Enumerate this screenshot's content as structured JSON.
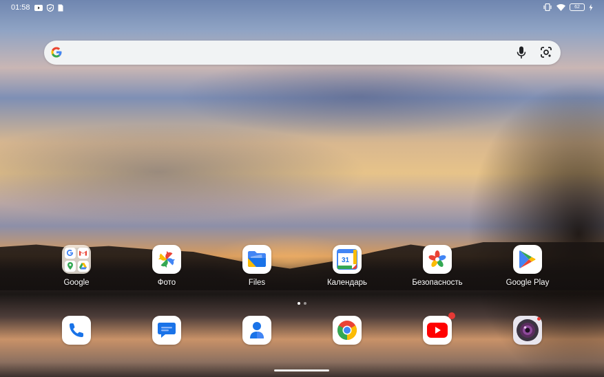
{
  "status_bar": {
    "time": "01:58",
    "battery": "62",
    "left_icons": [
      "youtube-icon",
      "shield-icon",
      "sim-icon"
    ],
    "right_icons": [
      "vibrate-icon",
      "wifi-icon",
      "battery-icon",
      "charging-icon"
    ]
  },
  "search": {
    "placeholder": "",
    "icons": [
      "google-logo-icon",
      "microphone-icon",
      "lens-icon"
    ]
  },
  "apps_row": [
    {
      "label": "Google",
      "icon": "google-folder-icon"
    },
    {
      "label": "Фото",
      "icon": "photos-icon"
    },
    {
      "label": "Files",
      "icon": "files-icon"
    },
    {
      "label": "Календарь",
      "icon": "calendar-icon",
      "day": "31"
    },
    {
      "label": "Безопасность",
      "icon": "security-icon"
    },
    {
      "label": "Google Play",
      "icon": "play-store-icon"
    }
  ],
  "dock": [
    {
      "icon": "phone-icon"
    },
    {
      "icon": "messages-icon"
    },
    {
      "icon": "contacts-icon"
    },
    {
      "icon": "chrome-icon"
    },
    {
      "icon": "youtube-app-icon",
      "badge": true
    },
    {
      "icon": "camera-icon",
      "badge": true
    }
  ],
  "colors": {
    "search_bg": "#f1f3f4",
    "google_blue": "#4285F4",
    "google_red": "#EA4335",
    "google_yellow": "#FBBC05",
    "google_green": "#34A853",
    "badge": "#e53935"
  },
  "pager": {
    "pages": 2,
    "current": 1
  }
}
